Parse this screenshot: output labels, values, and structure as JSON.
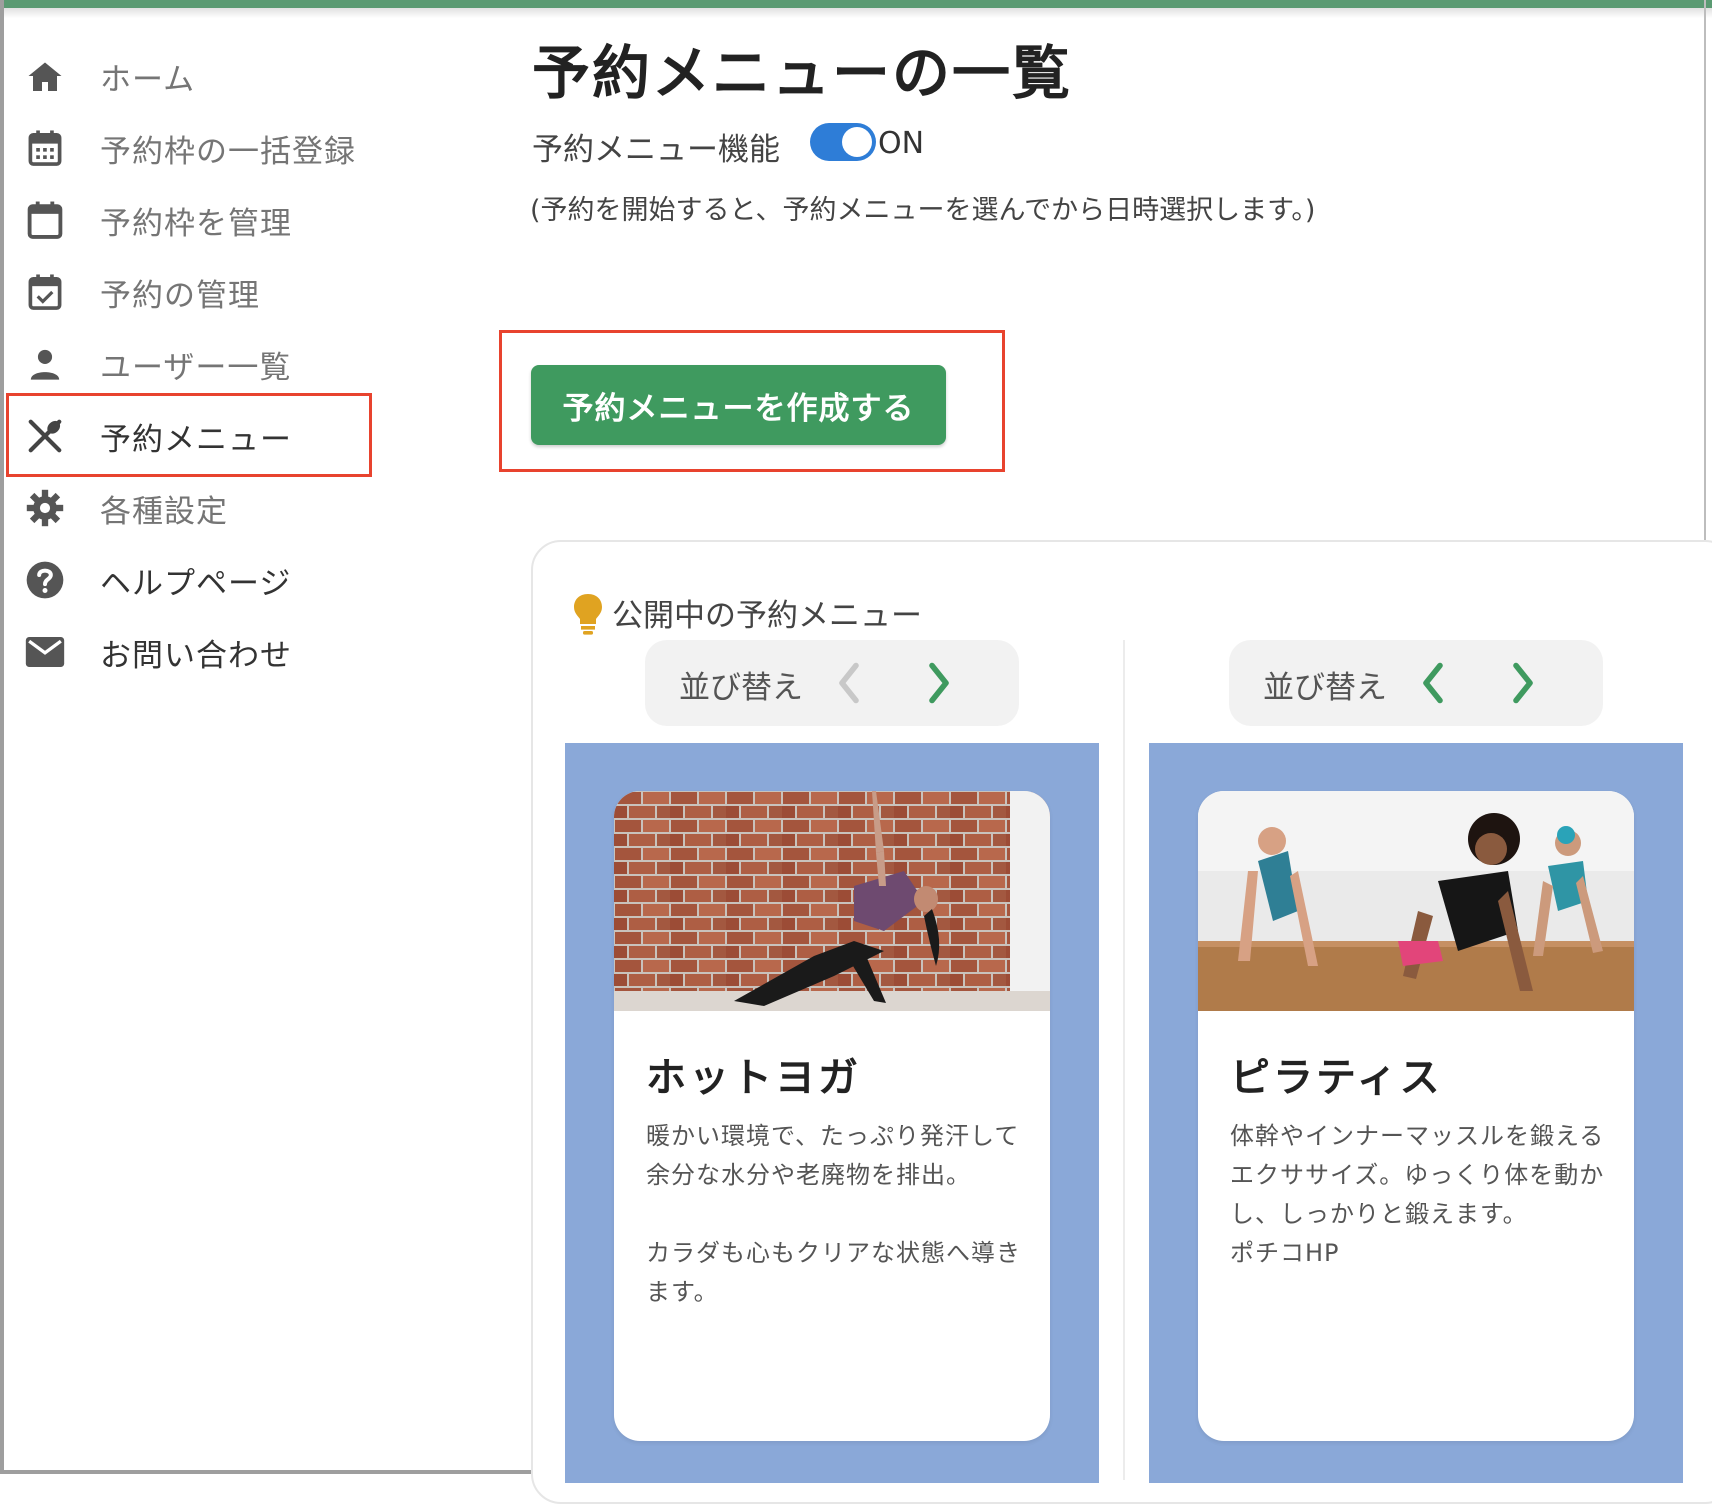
{
  "sidebar": {
    "items": [
      {
        "label": "ホーム",
        "icon": "home-icon"
      },
      {
        "label": "予約枠の一括登録",
        "icon": "calendar-grid-icon"
      },
      {
        "label": "予約枠を管理",
        "icon": "calendar-blank-icon"
      },
      {
        "label": "予約の管理",
        "icon": "calendar-check-icon"
      },
      {
        "label": "ユーザー一覧",
        "icon": "person-icon"
      },
      {
        "label": "予約メニュー",
        "icon": "utensils-icon"
      },
      {
        "label": "各種設定",
        "icon": "gear-icon"
      },
      {
        "label": "ヘルプページ",
        "icon": "help-circle-icon"
      },
      {
        "label": "お問い合わせ",
        "icon": "mail-icon"
      }
    ]
  },
  "main": {
    "title": "予約メニューの一覧",
    "feature_label": "予約メニュー機能",
    "toggle_state": "ON",
    "note": "(予約を開始すると、予約メニューを選んでから日時選択します。)",
    "create_button": "予約メニューを作成する",
    "panel_title": "公開中の予約メニュー",
    "sort_label": "並び替え",
    "menus": [
      {
        "name": "ホットヨガ",
        "description": "暖かい環境で、たっぷり発汗して余分な水分や老廃物を排出。\n\nカラダも心もクリアな状態へ導きます。"
      },
      {
        "name": "ピラティス",
        "description": "体幹やインナーマッスルを鍛えるエクササイズ。ゆっくり体を動かし、しっかりと鍛えます。\nポチコHP"
      }
    ]
  },
  "colors": {
    "accent_green": "#3f9a5f",
    "highlight_red": "#e8432e",
    "toggle_blue": "#2e7dd7",
    "card_bg_blue": "#8aa8d8",
    "top_bar": "#5a9a72"
  }
}
